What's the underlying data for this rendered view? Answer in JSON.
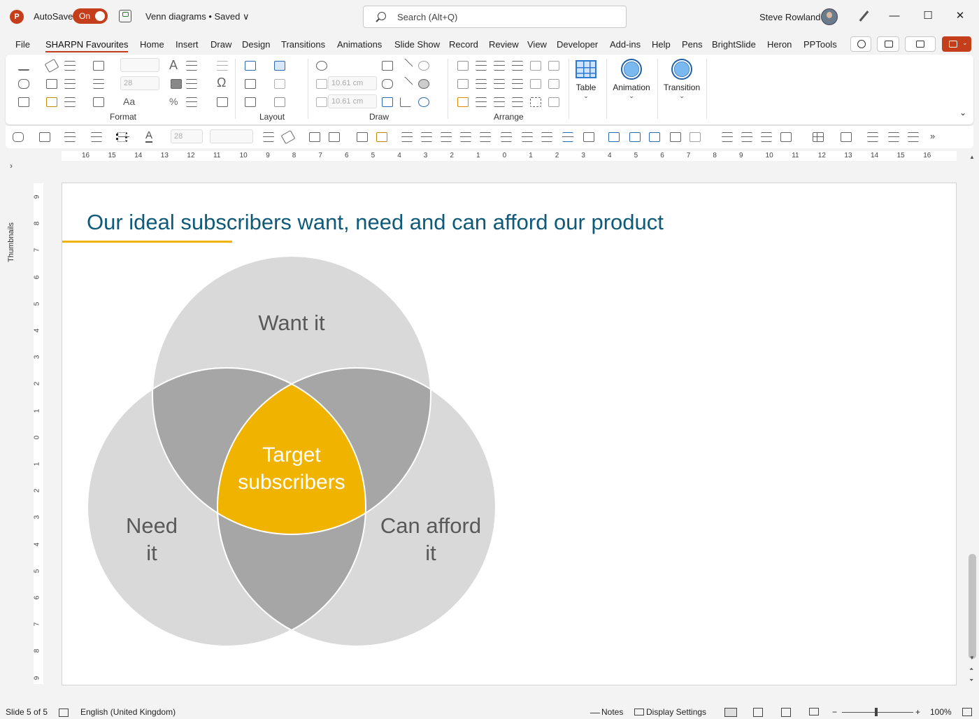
{
  "titlebar": {
    "app_logo": "P",
    "autosave_label": "AutoSave",
    "autosave_state": "On",
    "doc_title": "Venn diagrams • Saved ∨",
    "search_placeholder": "Search (Alt+Q)",
    "user_name": "Steve Rowland",
    "minimize": "—",
    "maximize": "☐",
    "close": "✕"
  },
  "tabs": [
    "File",
    "SHARPN Favourites",
    "Home",
    "Insert",
    "Draw",
    "Design",
    "Transitions",
    "Animations",
    "Slide Show",
    "Record",
    "Review",
    "View",
    "Developer",
    "Add-ins",
    "Help",
    "Pens",
    "BrightSlide",
    "Heron",
    "PPTools"
  ],
  "active_tab": "SHARPN Favourites",
  "ribbon": {
    "groups": [
      "Format",
      "Layout",
      "Draw",
      "Arrange"
    ],
    "font_size_value": "28",
    "height_value": "10.61 cm",
    "width_value": "10.61 cm",
    "table_label": "Table",
    "animation_label": "Animation",
    "transition_label": "Transition",
    "qat_font_size": "28"
  },
  "ruler": {
    "horizontal_ticks": [
      "16",
      "15",
      "14",
      "13",
      "12",
      "11",
      "10",
      "9",
      "8",
      "7",
      "6",
      "5",
      "4",
      "3",
      "2",
      "1",
      "0",
      "1",
      "2",
      "3",
      "4",
      "5",
      "6",
      "7",
      "8",
      "9",
      "10",
      "11",
      "12",
      "13",
      "14",
      "15",
      "16"
    ],
    "vertical_ticks": [
      "9",
      "8",
      "7",
      "6",
      "5",
      "4",
      "3",
      "2",
      "1",
      "0",
      "1",
      "2",
      "3",
      "4",
      "5",
      "6",
      "7",
      "8",
      "9"
    ]
  },
  "sidebar": {
    "thumbnails_label": "Thumbnails"
  },
  "slide": {
    "title": "Our ideal subscribers want, need and can afford our product",
    "venn": {
      "top_label": "Want it",
      "left_label_line1": "Need",
      "left_label_line2": "it",
      "right_label_line1": "Can afford",
      "right_label_line2": "it",
      "center_label_line1": "Target",
      "center_label_line2": "subscribers"
    },
    "colors": {
      "title": "#0e5a7a",
      "accent": "#f0b400",
      "circle": "#d9d9d9",
      "overlap": "#a6a6a6",
      "label": "#595959"
    }
  },
  "status": {
    "slide_info": "Slide 5 of 5",
    "language": "English (United Kingdom)",
    "notes": "Notes",
    "display_settings": "Display Settings",
    "zoom_minus": "−",
    "zoom_plus": "+",
    "zoom": "100%"
  }
}
